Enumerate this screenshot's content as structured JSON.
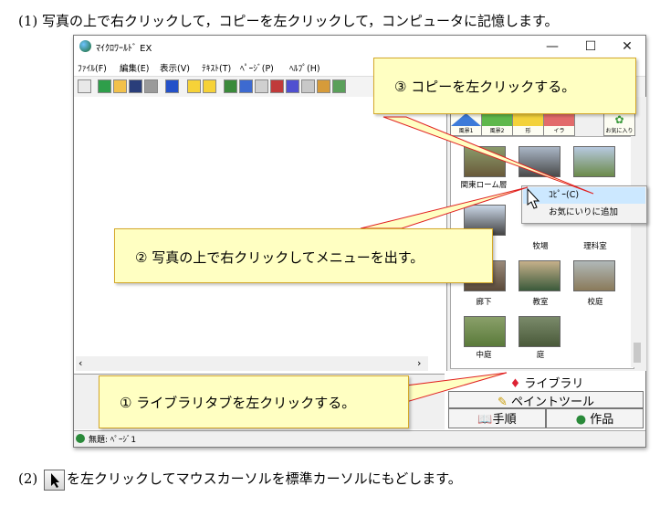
{
  "step1": {
    "text": "(1) 写真の上で右クリックして，コピーを左クリックして，コンピュータに記憶します。"
  },
  "window": {
    "title": "ﾏｲｸﾛﾜｰﾙﾄﾞ EX",
    "minimize": "—",
    "maximize": "☐",
    "close": "✕"
  },
  "menu": [
    "ﾌｧｲﾙ(F)",
    "編集(E)",
    "表示(V)",
    "ﾃｷｽﾄ(T)",
    "ﾍﾟｰｼﾞ(P)",
    "ﾍﾙﾌﾟ(H)"
  ],
  "categories": [
    "風景1",
    "風景2",
    "形",
    "イラ",
    "お気に入り"
  ],
  "thumbnails": [
    {
      "label": "関東ローム層"
    },
    {
      "label": ""
    },
    {
      "label": ""
    },
    {
      "label": "牧場"
    },
    {
      "label": "理科室"
    },
    {
      "label": "廊下"
    },
    {
      "label": "教室"
    },
    {
      "label": "校庭"
    },
    {
      "label": "中庭"
    },
    {
      "label": "庭"
    }
  ],
  "context_menu": {
    "copy": "ｺﾋﾟｰ(C)",
    "favorite": "お気にいりに追加"
  },
  "tabs": {
    "library": "ライブラリ",
    "paint": "ペイントツール",
    "procedure": "手順",
    "work": "作品"
  },
  "status": {
    "text": "無題: ﾍﾟｰｼﾞ1"
  },
  "callouts": {
    "c1": "① ライブラリタブを左クリックする。",
    "c2": "② 写真の上で右クリックしてメニューを出す。",
    "c3": "③ コピーを左クリックする。"
  },
  "step2": {
    "prefix": "(2)",
    "text": "を左クリックしてマウスカーソルを標準カーソルにもどします。"
  },
  "colors": {
    "callout_bg": "#ffffc2",
    "callout_border": "#d4a82a",
    "pointer_line": "#e02020",
    "ctx_highlight": "#cce8ff"
  }
}
